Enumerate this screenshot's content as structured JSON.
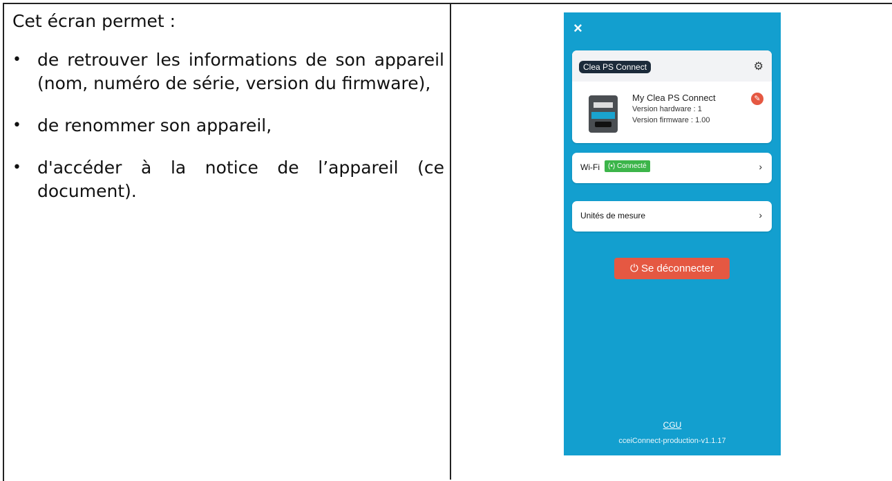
{
  "left": {
    "intro": "Cet écran permet :",
    "bullets": [
      "de retrouver les informations de son appareil (nom, numéro de série, version du firmware),",
      "de renommer son appareil,",
      "d'accéder à la notice de l’appareil (ce document)."
    ],
    "bullet_glyph": "•"
  },
  "phone": {
    "close_icon": "×",
    "device_card": {
      "tag": "Clea PS Connect",
      "settings_icon": "gear-icon",
      "name": "My Clea PS Connect",
      "hardware": "Version hardware : 1",
      "firmware": "Version firmware : 1.00",
      "edit_icon": "pencil-icon"
    },
    "wifi": {
      "label": "Wi-Fi",
      "status": "(•) Connecté"
    },
    "units": {
      "label": "Unités de mesure"
    },
    "chevron": "›",
    "logout": "⏻ Se déconnecter",
    "cgu": "CGU",
    "version": "cceiConnect-production-v1.1.17"
  },
  "colors": {
    "phone_bg": "#139fcf",
    "danger": "#e55842",
    "success": "#3cb54a",
    "tag_bg": "#1c2b3a"
  }
}
